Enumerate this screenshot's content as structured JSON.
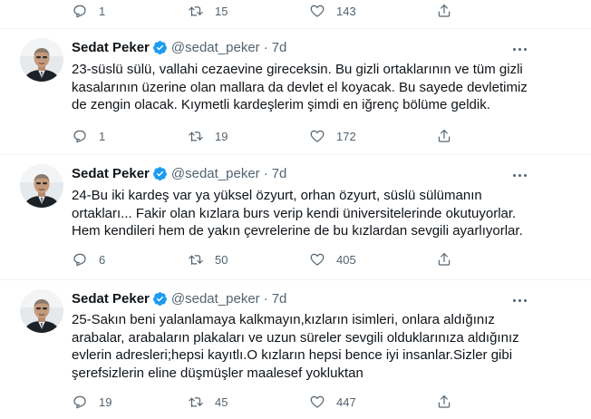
{
  "top_actions": {
    "reply": "1",
    "retweet": "15",
    "like": "143"
  },
  "tweets": [
    {
      "name": "Sedat Peker",
      "handle": "@sedat_peker",
      "separator": "·",
      "time": "7d",
      "text": "23-süslü sülü, vallahi cezaevine gireceksin.  Bu gizli ortaklarının ve tüm gizli\nkasalarının üzerine olan mallara da devlet el koyacak.  Bu sayede devletimiz\nde zengin olacak. Kıymetli kardeşlerim şimdi en iğrenç bölüme geldik.",
      "reply": "1",
      "retweet": "19",
      "like": "172"
    },
    {
      "name": "Sedat Peker",
      "handle": "@sedat_peker",
      "separator": "·",
      "time": "7d",
      "text": "24-Bu iki kardeş var ya yüksel özyurt, orhan özyurt, süslü sülümanın\nortakları... Fakir olan kızlara burs verip kendi üniversitelerinde okutuyorlar.\nHem kendileri hem de yakın çevrelerine de bu kızlardan sevgili ayarlıyorlar.",
      "reply": "6",
      "retweet": "50",
      "like": "405"
    },
    {
      "name": "Sedat Peker",
      "handle": "@sedat_peker",
      "separator": "·",
      "time": "7d",
      "text": "25-Sakın beni yalanlamaya kalkmayın,kızların isimleri, onlara aldığınız\narabalar,  arabaların plakaları ve uzun süreler sevgili olduklarınıza aldığınız\nevlerin adresleri;hepsi kayıtlı.O kızların hepsi bence iyi insanlar.Sizler gibi\nşerefsizlerin eline düşmüşler maalesef yokluktan",
      "reply": "19",
      "retweet": "45",
      "like": "447"
    }
  ],
  "colors": {
    "text": "#0f1419",
    "muted": "#536471",
    "verified": "#1d9bf0",
    "divider": "#eff3f4"
  },
  "icons": {
    "reply": "reply-icon",
    "retweet": "retweet-icon",
    "like": "heart-icon",
    "share": "share-icon",
    "more": "more-icon",
    "verified": "verified-badge-icon"
  }
}
